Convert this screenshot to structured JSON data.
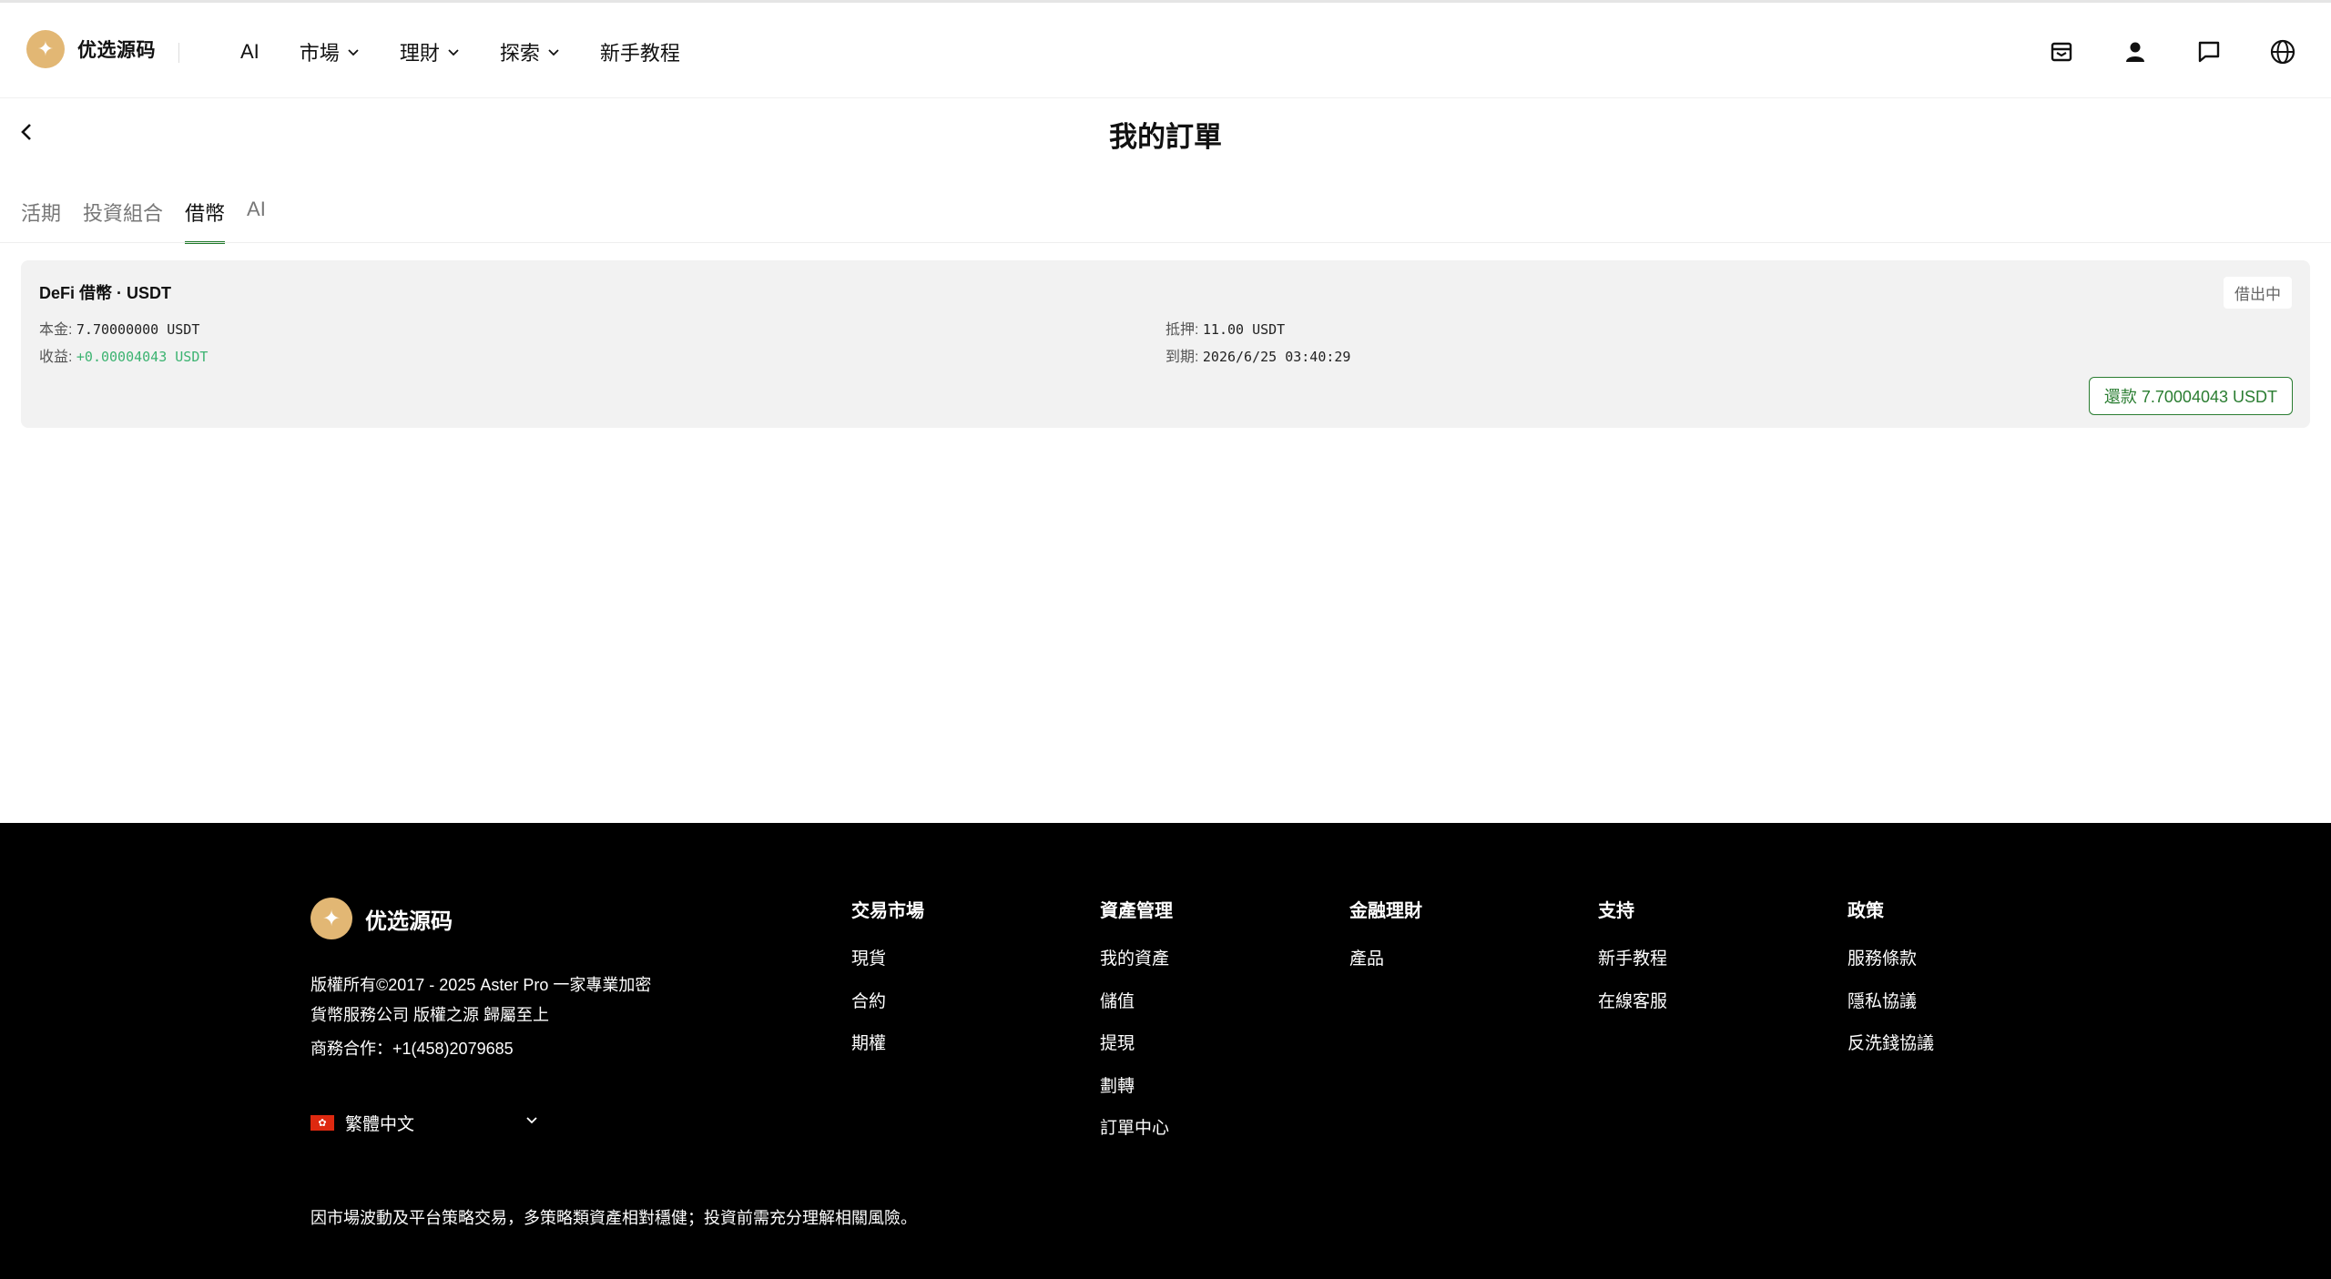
{
  "header": {
    "brand": "优选源码",
    "logo_glyph": "✦",
    "nav": [
      {
        "label": "AI",
        "has_dropdown": false
      },
      {
        "label": "市場",
        "has_dropdown": true
      },
      {
        "label": "理財",
        "has_dropdown": true
      },
      {
        "label": "探索",
        "has_dropdown": true
      },
      {
        "label": "新手教程",
        "has_dropdown": false
      }
    ],
    "icons": [
      "mailbox-icon",
      "user-icon",
      "message-icon",
      "globe-icon"
    ]
  },
  "page": {
    "title": "我的訂單",
    "tabs": [
      {
        "label": "活期",
        "active": false
      },
      {
        "label": "投資組合",
        "active": false
      },
      {
        "label": "借幣",
        "active": true
      },
      {
        "label": "AI",
        "active": false
      }
    ]
  },
  "order": {
    "title": "DeFi 借幣 · USDT",
    "status": "借出中",
    "principal_label": "本金:",
    "principal_value": "7.70000000 USDT",
    "earnings_label": "收益:",
    "earnings_value": "+0.00004043 USDT",
    "collateral_label": "抵押:",
    "collateral_value": "11.00 USDT",
    "due_label": "到期:",
    "due_value": "2026/6/25 03:40:29",
    "repay_button": "還款 7.70004043 USDT"
  },
  "footer": {
    "brand": "优选源码",
    "copyright": "版權所有©2017 - 2025 Aster Pro 一家專業加密貨幣服務公司 版權之源 歸屬至上",
    "contact": "商務合作：+1(458)2079685",
    "language": "繁體中文",
    "columns": [
      {
        "title": "交易市場",
        "links": [
          "現貨",
          "合約",
          "期權"
        ]
      },
      {
        "title": "資產管理",
        "links": [
          "我的資產",
          "儲值",
          "提現",
          "劃轉",
          "訂單中心"
        ]
      },
      {
        "title": "金融理財",
        "links": [
          "產品"
        ]
      },
      {
        "title": "支持",
        "links": [
          "新手教程",
          "在線客服"
        ]
      },
      {
        "title": "政策",
        "links": [
          "服務條款",
          "隱私協議",
          "反洗錢協議"
        ]
      }
    ],
    "disclaimer": "因市場波動及平台策略交易，多策略類資產相對穩健；投資前需充分理解相關風險。"
  },
  "colors": {
    "accent_green": "#1f7a2a",
    "logo_gold": "#e2b774",
    "earnings_green": "#3cb371"
  }
}
